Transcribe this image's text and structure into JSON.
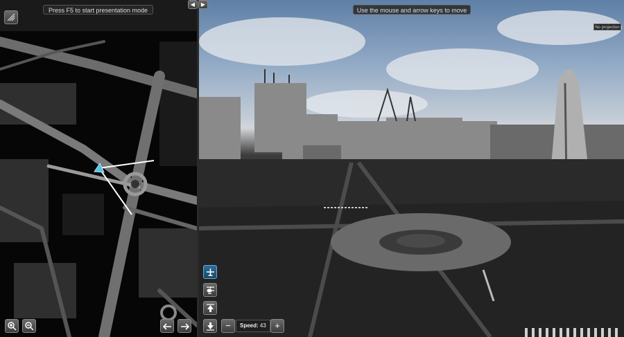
{
  "banners": {
    "presentation": "Press F5 to start presentation mode",
    "navigation_hint": "Use the mouse and arrow keys to move"
  },
  "projection_badge": "No projection",
  "panel_toggles": {
    "collapse_left": "◀",
    "collapse_right": "▶"
  },
  "map_controls": {
    "zoom_in_icon": "zoom-in-icon",
    "zoom_out_icon": "zoom-out-icon",
    "rotate_left_icon": "arrow-left-icon",
    "rotate_right_icon": "arrow-right-icon",
    "layer_icon": "layers-icon"
  },
  "navigation_modes": [
    {
      "name": "fly",
      "icon": "airplane-icon",
      "active": true
    },
    {
      "name": "helicopter",
      "icon": "helicopter-icon",
      "active": false
    },
    {
      "name": "ascend",
      "icon": "arrow-up-icon",
      "active": false
    },
    {
      "name": "descend",
      "icon": "arrow-down-icon",
      "active": false
    }
  ],
  "speed": {
    "label": "Speed:",
    "value": "43",
    "minus": "−",
    "plus": "+"
  },
  "colors": {
    "active_button": "#2d6f9a",
    "camera_marker": "#4fc7e0",
    "banner_bg": "#282828"
  }
}
